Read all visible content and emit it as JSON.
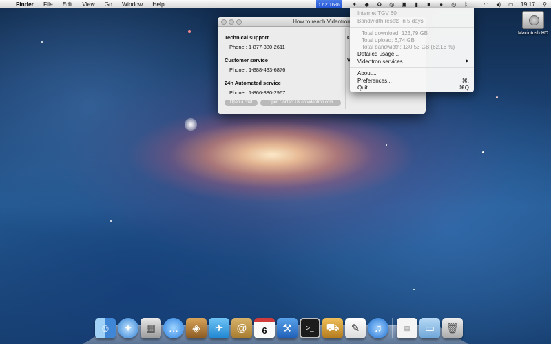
{
  "menubar": {
    "apple_icon": "apple-icon",
    "items": [
      "Finder",
      "File",
      "Edit",
      "View",
      "Go",
      "Window",
      "Help"
    ],
    "usage_badge": "62.16%",
    "clock": "19:17"
  },
  "window": {
    "title": "How to reach Videotron",
    "sections": [
      {
        "title": "Technical support",
        "phone": "Phone : 1-877-380-2611"
      },
      {
        "title": "Customer service",
        "phone": "Phone : 1-888-433-6876"
      },
      {
        "title": "24h Automated service",
        "phone": "Phone : 1-866-380-2967"
      }
    ],
    "buttons": [
      "Open a chat",
      "Open Contact Us on videotron.com"
    ],
    "right_fragments": [
      "C",
      "V"
    ]
  },
  "menu": {
    "plan": "Internet TGV 60",
    "reset": "Bandwidth resets in 5 days",
    "download": "Total download: 123,79 GB",
    "upload": "Total upload: 6,74 GB",
    "bandwidth": "Total bandwidth: 130,53 GB (62.16 %)",
    "detailed": "Detailed usage...",
    "services": "Videotron services",
    "services_arrow": "▶",
    "about": "About...",
    "preferences": "Preferences...",
    "preferences_shortcut": "⌘,",
    "quit": "Quit",
    "quit_shortcut": "⌘Q"
  },
  "desktop": {
    "drive_label": "Macintosh HD"
  },
  "dock": {
    "icons": [
      "finder-icon",
      "safari-icon",
      "preview-icon",
      "messages-icon",
      "itunes-box-icon",
      "twitter-icon",
      "address-book-icon",
      "calendar-icon",
      "xcode-icon",
      "terminal-icon",
      "transmit-icon",
      "textedit-icon",
      "itunes-icon",
      "pdf-document-icon",
      "folder-icon",
      "trash-icon"
    ],
    "calendar_day": "6"
  },
  "colors": {
    "menu_highlight": "#2f62e0",
    "accent_blue": "#2a5fc9"
  }
}
